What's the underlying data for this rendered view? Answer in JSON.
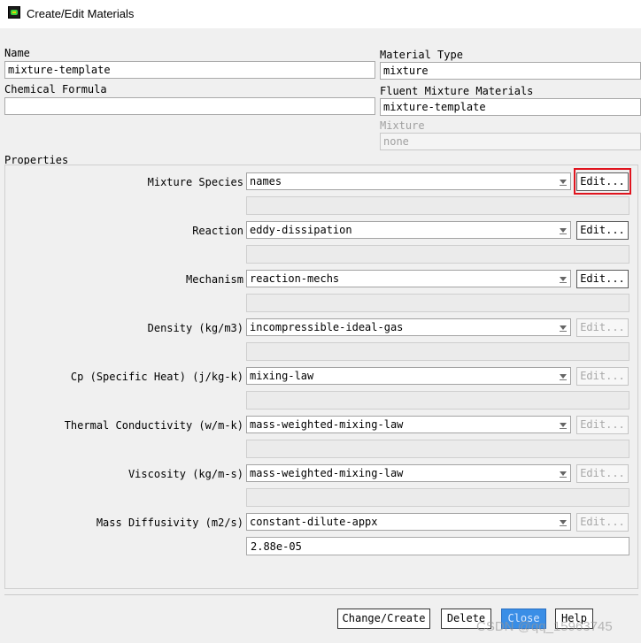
{
  "window": {
    "title": "Create/Edit Materials"
  },
  "name": {
    "label": "Name",
    "value": "mixture-template"
  },
  "chemical_formula": {
    "label": "Chemical Formula",
    "value": ""
  },
  "material_type": {
    "label": "Material Type",
    "value": "mixture"
  },
  "fluent_mixture_materials": {
    "label": "Fluent Mixture Materials",
    "value": "mixture-template"
  },
  "mixture": {
    "label": "Mixture",
    "value": "none"
  },
  "properties": {
    "label": "Properties",
    "rows": [
      {
        "label": "Mixture Species",
        "value": "names",
        "edit": "Edit..."
      },
      {
        "label": "Reaction",
        "value": "eddy-dissipation",
        "edit": "Edit..."
      },
      {
        "label": "Mechanism",
        "value": "reaction-mechs",
        "edit": "Edit..."
      },
      {
        "label": "Density (kg/m3)",
        "value": "incompressible-ideal-gas",
        "edit": "Edit..."
      },
      {
        "label": "Cp (Specific Heat) (j/kg-k)",
        "value": "mixing-law",
        "edit": "Edit..."
      },
      {
        "label": "Thermal Conductivity (w/m-k)",
        "value": "mass-weighted-mixing-law",
        "edit": "Edit..."
      },
      {
        "label": "Viscosity (kg/m-s)",
        "value": "mass-weighted-mixing-law",
        "edit": "Edit..."
      },
      {
        "label": "Mass Diffusivity (m2/s)",
        "value": "constant-dilute-appx",
        "edit": "Edit...",
        "sub_value": "2.88e-05"
      }
    ]
  },
  "buttons": {
    "change_create": "Change/Create",
    "delete": "Delete",
    "close": "Close",
    "help": "Help"
  },
  "watermark": "CSDN @qq_15963745",
  "colors": {
    "highlight": "#e0141e",
    "primary_button": "#3a8ee6"
  }
}
